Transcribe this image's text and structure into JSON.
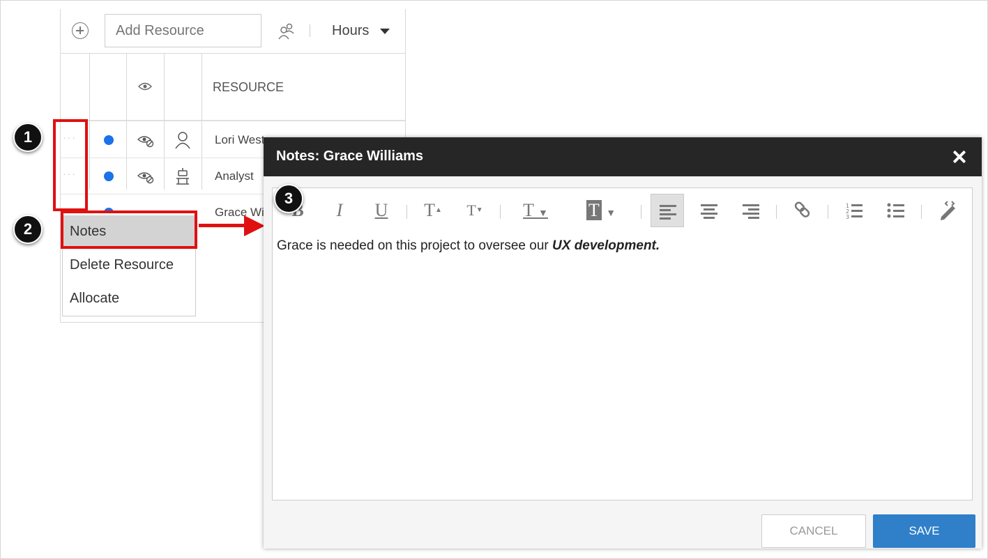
{
  "toolbar": {
    "add_placeholder": "Add Resource",
    "hours_label": "Hours"
  },
  "table": {
    "resource_header": "RESOURCE",
    "rows": [
      {
        "name": "Lori West"
      },
      {
        "name": "Analyst"
      },
      {
        "name": "Grace Wi"
      }
    ]
  },
  "context_menu": {
    "items": [
      "Notes",
      "Delete Resource",
      "Allocate"
    ]
  },
  "callouts": [
    "1",
    "2",
    "3"
  ],
  "dialog": {
    "title": "Notes: Grace Williams",
    "note_plain": "Grace is needed on this project to oversee our ",
    "note_bold": "UX development.",
    "cancel_label": "CANCEL",
    "save_label": "SAVE"
  },
  "colors": {
    "accent": "#2f7fc9",
    "highlight": "#e01010",
    "status_dot": "#1a73e8",
    "dialog_header": "#262626"
  }
}
